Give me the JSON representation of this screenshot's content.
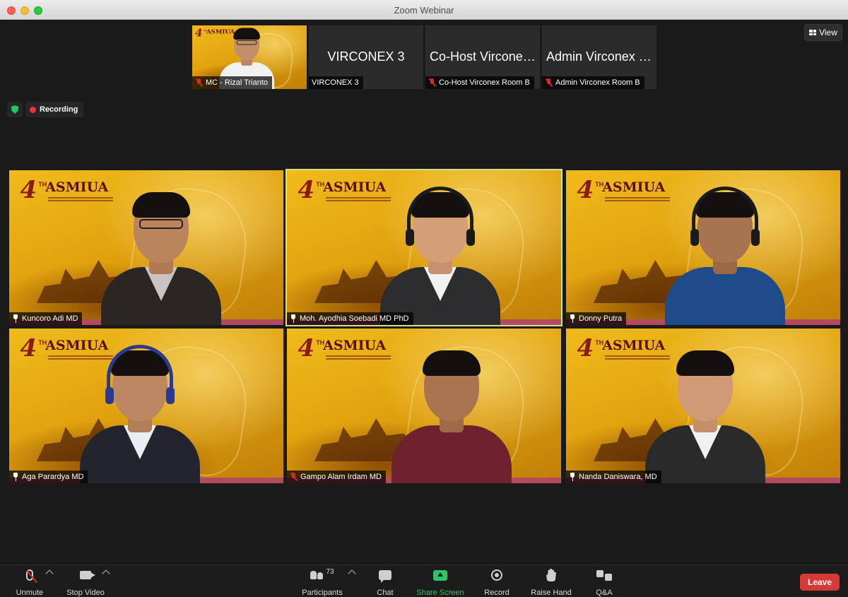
{
  "window": {
    "title": "Zoom Webinar"
  },
  "top_strip": [
    {
      "display_name": "",
      "label": "MC - Rizal Trianto",
      "muted": true,
      "video": true
    },
    {
      "display_name": "VIRCONEX 3",
      "label": "VIRCONEX 3",
      "muted": false,
      "video": false
    },
    {
      "display_name": "Co-Host Virconex Room B",
      "label": "Co-Host Virconex Room B",
      "muted": true,
      "video": false
    },
    {
      "display_name": "Admin Virconex Room B",
      "label": "Admin Virconex Room B",
      "muted": true,
      "video": false
    }
  ],
  "view_button": {
    "label": "View",
    "icon": "grid-icon"
  },
  "recording": {
    "label": "Recording",
    "status_color": "#e8323c",
    "shield_color": "#23c55e"
  },
  "branding": {
    "logo_number": "4",
    "logo_superscript": "TH",
    "logo_word": "ASMIUA"
  },
  "gallery": [
    {
      "name": "Kuncoro Adi MD",
      "icon": "pin-icon",
      "active": false
    },
    {
      "name": "Moh. Ayodhia Soebadi MD PhD",
      "icon": "pin-icon",
      "active": true
    },
    {
      "name": "Donny Putra",
      "icon": "pin-icon",
      "active": false
    },
    {
      "name": "Aga Parardya MD",
      "icon": "pin-icon",
      "active": false
    },
    {
      "name": "Gampo Alam Irdam MD",
      "icon": "mic-muted-icon",
      "active": false
    },
    {
      "name": "Nanda Daniswara, MD",
      "icon": "pin-icon",
      "active": false
    }
  ],
  "toolbar": {
    "unmute": "Unmute",
    "stop_video": "Stop Video",
    "participants": "Participants",
    "participants_count": "73",
    "chat": "Chat",
    "share_screen": "Share Screen",
    "record": "Record",
    "raise_hand": "Raise Hand",
    "qa": "Q&A",
    "leave": "Leave"
  },
  "colors": {
    "accent_green": "#2cc56b",
    "leave_red": "#d63a36",
    "active_speaker": "#cfe28a"
  }
}
